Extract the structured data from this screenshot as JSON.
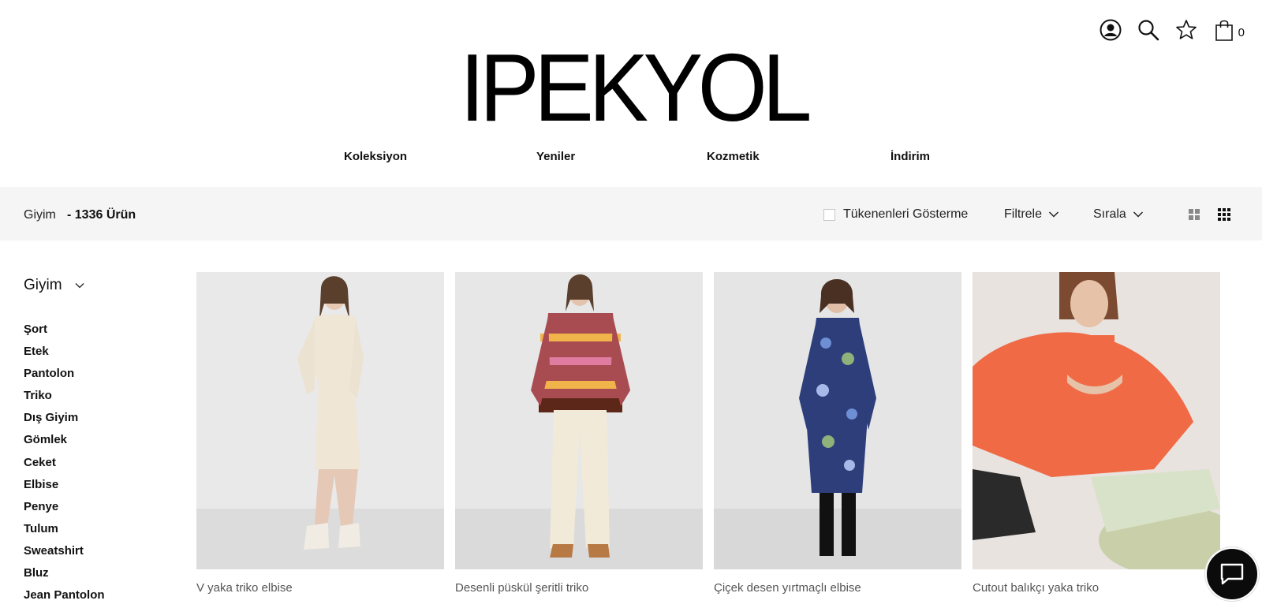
{
  "brand": {
    "logo_text": "IPEKYOL"
  },
  "header": {
    "icons": [
      "account-icon",
      "search-icon",
      "favorites-star-icon",
      "shopping-bag-icon"
    ],
    "cart_count": "0"
  },
  "nav": {
    "items": [
      {
        "label": "Koleksiyon"
      },
      {
        "label": "Yeniler"
      },
      {
        "label": "Kozmetik"
      },
      {
        "label": "İndirim"
      }
    ]
  },
  "toolbar": {
    "breadcrumb": "Giyim",
    "product_count": "- 1336 Ürün",
    "hide_out_of_stock_label": "Tükenenleri Gösterme",
    "filter_label": "Filtrele",
    "sort_label": "Sırala"
  },
  "sidebar": {
    "title": "Giyim",
    "items": [
      {
        "label": "Şort"
      },
      {
        "label": "Etek"
      },
      {
        "label": "Pantolon"
      },
      {
        "label": "Triko"
      },
      {
        "label": "Dış Giyim"
      },
      {
        "label": "Gömlek"
      },
      {
        "label": "Ceket"
      },
      {
        "label": "Elbise"
      },
      {
        "label": "Penye"
      },
      {
        "label": "Tulum"
      },
      {
        "label": "Sweatshirt"
      },
      {
        "label": "Bluz"
      },
      {
        "label": "Jean Pantolon"
      }
    ]
  },
  "products": [
    {
      "name": "V yaka triko elbise"
    },
    {
      "name": "Desenli püskül şeritli triko"
    },
    {
      "name": "Çiçek desen yırtmaçlı elbise"
    },
    {
      "name": "Cutout balıkçı yaka triko"
    }
  ],
  "colors": {
    "toolbar_bg": "#f5f5f5",
    "text": "#111111",
    "chat_button": "#0b0b0b"
  }
}
